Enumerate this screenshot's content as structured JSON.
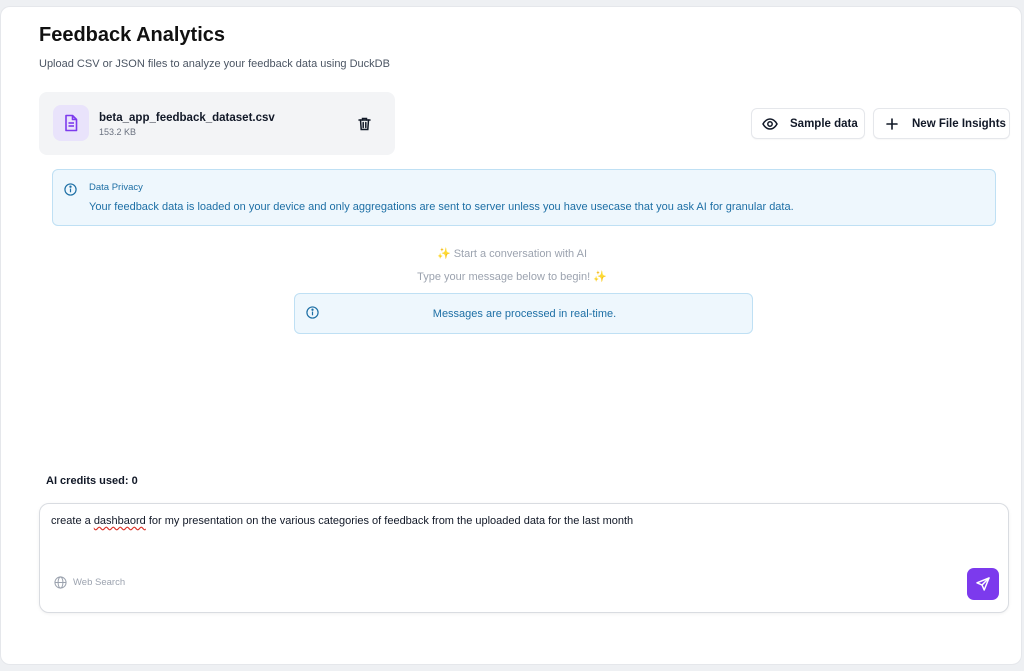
{
  "header": {
    "title": "Feedback Analytics",
    "subtitle": "Upload CSV or JSON files to analyze your feedback data using DuckDB"
  },
  "file": {
    "name": "beta_app_feedback_dataset.csv",
    "size": "153.2 KB",
    "icon": "file-text-icon",
    "delete_icon": "trash-icon"
  },
  "actions": {
    "sample_label": "Sample data",
    "sample_icon": "eye-icon",
    "new_label": "New File Insights",
    "new_icon": "plus-icon"
  },
  "privacy": {
    "title": "Data Privacy",
    "text": "Your feedback data is loaded on your device and only aggregations are sent to server unless you have usecase that you ask AI for granular data.",
    "icon": "info-icon"
  },
  "conversation": {
    "start_line_1": "✨ Start a conversation with AI",
    "start_line_2": "Type your message below to begin! ✨",
    "realtime_note": "Messages are processed in real-time."
  },
  "credits": {
    "label": "AI credits used: 0"
  },
  "composer": {
    "text_before": "create a ",
    "misspelled_word": "dashbaord",
    "text_after": " for my presentation on the various categories of feedback from the uploaded data for the last month",
    "web_search_label": "Web Search",
    "web_search_icon": "globe-icon",
    "send_icon": "send-icon"
  },
  "colors": {
    "accent": "#7c3aed",
    "info_text": "#1d6fa5",
    "info_bg": "#eef7fd",
    "info_border": "#bfe0f4"
  }
}
